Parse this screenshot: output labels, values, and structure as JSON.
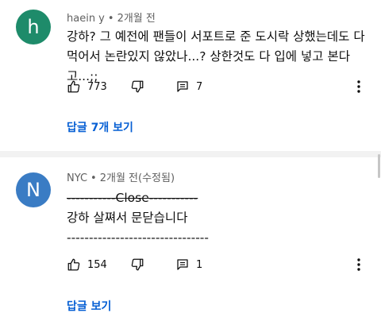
{
  "comments": [
    {
      "avatar_letter": "h",
      "avatar_color": "#1e8b6a",
      "author": "haein y",
      "separator": "•",
      "time": "2개월 전",
      "lines": [
        "강하? 그 예전에 팬들이 서포트로 준 도시락 상했는데도 다",
        "먹어서 논란있지 않았나...? 상한것도 다 입에 넣고 본다고...;;"
      ],
      "likes": "773",
      "replies_count": "7",
      "replies_link": "답글 7개 보기"
    },
    {
      "avatar_letter": "N",
      "avatar_color": "#3a7cc4",
      "author": "NYC",
      "separator": "•",
      "time": "2개월 전(수정됨)",
      "lines": [
        "-----------Close-----------",
        "강하 살쪄서 문닫습니다",
        "--------------------------------"
      ],
      "likes": "154",
      "replies_count": "1",
      "replies_link": "답글 보기"
    }
  ]
}
